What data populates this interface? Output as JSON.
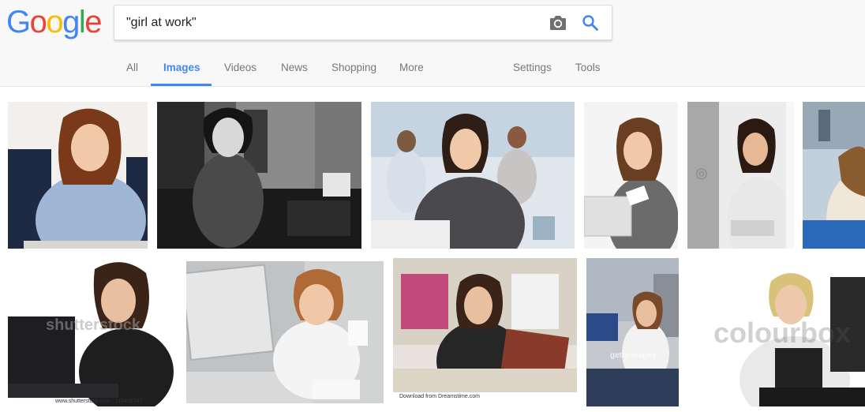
{
  "logo": {
    "text": "Google",
    "letters": [
      "G",
      "o",
      "o",
      "g",
      "l",
      "e"
    ]
  },
  "search": {
    "query": "\"girl at work\""
  },
  "icons": {
    "camera": "camera-icon",
    "search": "search-icon"
  },
  "tabs": [
    {
      "label": "All"
    },
    {
      "label": "Images",
      "active": true
    },
    {
      "label": "Videos"
    },
    {
      "label": "News"
    },
    {
      "label": "Shopping"
    },
    {
      "label": "More"
    },
    {
      "label": "Settings"
    },
    {
      "label": "Tools"
    }
  ],
  "colors": {
    "google_blue": "#4285f4",
    "google_red": "#ea4335",
    "google_yellow": "#fbbc05",
    "google_green": "#34a853",
    "tab_text": "#777777",
    "header_bg": "#f8f8f8"
  },
  "results": {
    "watermarks": {
      "shutterstock": "shutterstock",
      "shutterstock_credit": "www.shutterstock.com · 114436747",
      "gettyimages": "gettyimages",
      "colourbox": "colourbox",
      "dreamstime": "Download from Dreamstime.com"
    }
  }
}
